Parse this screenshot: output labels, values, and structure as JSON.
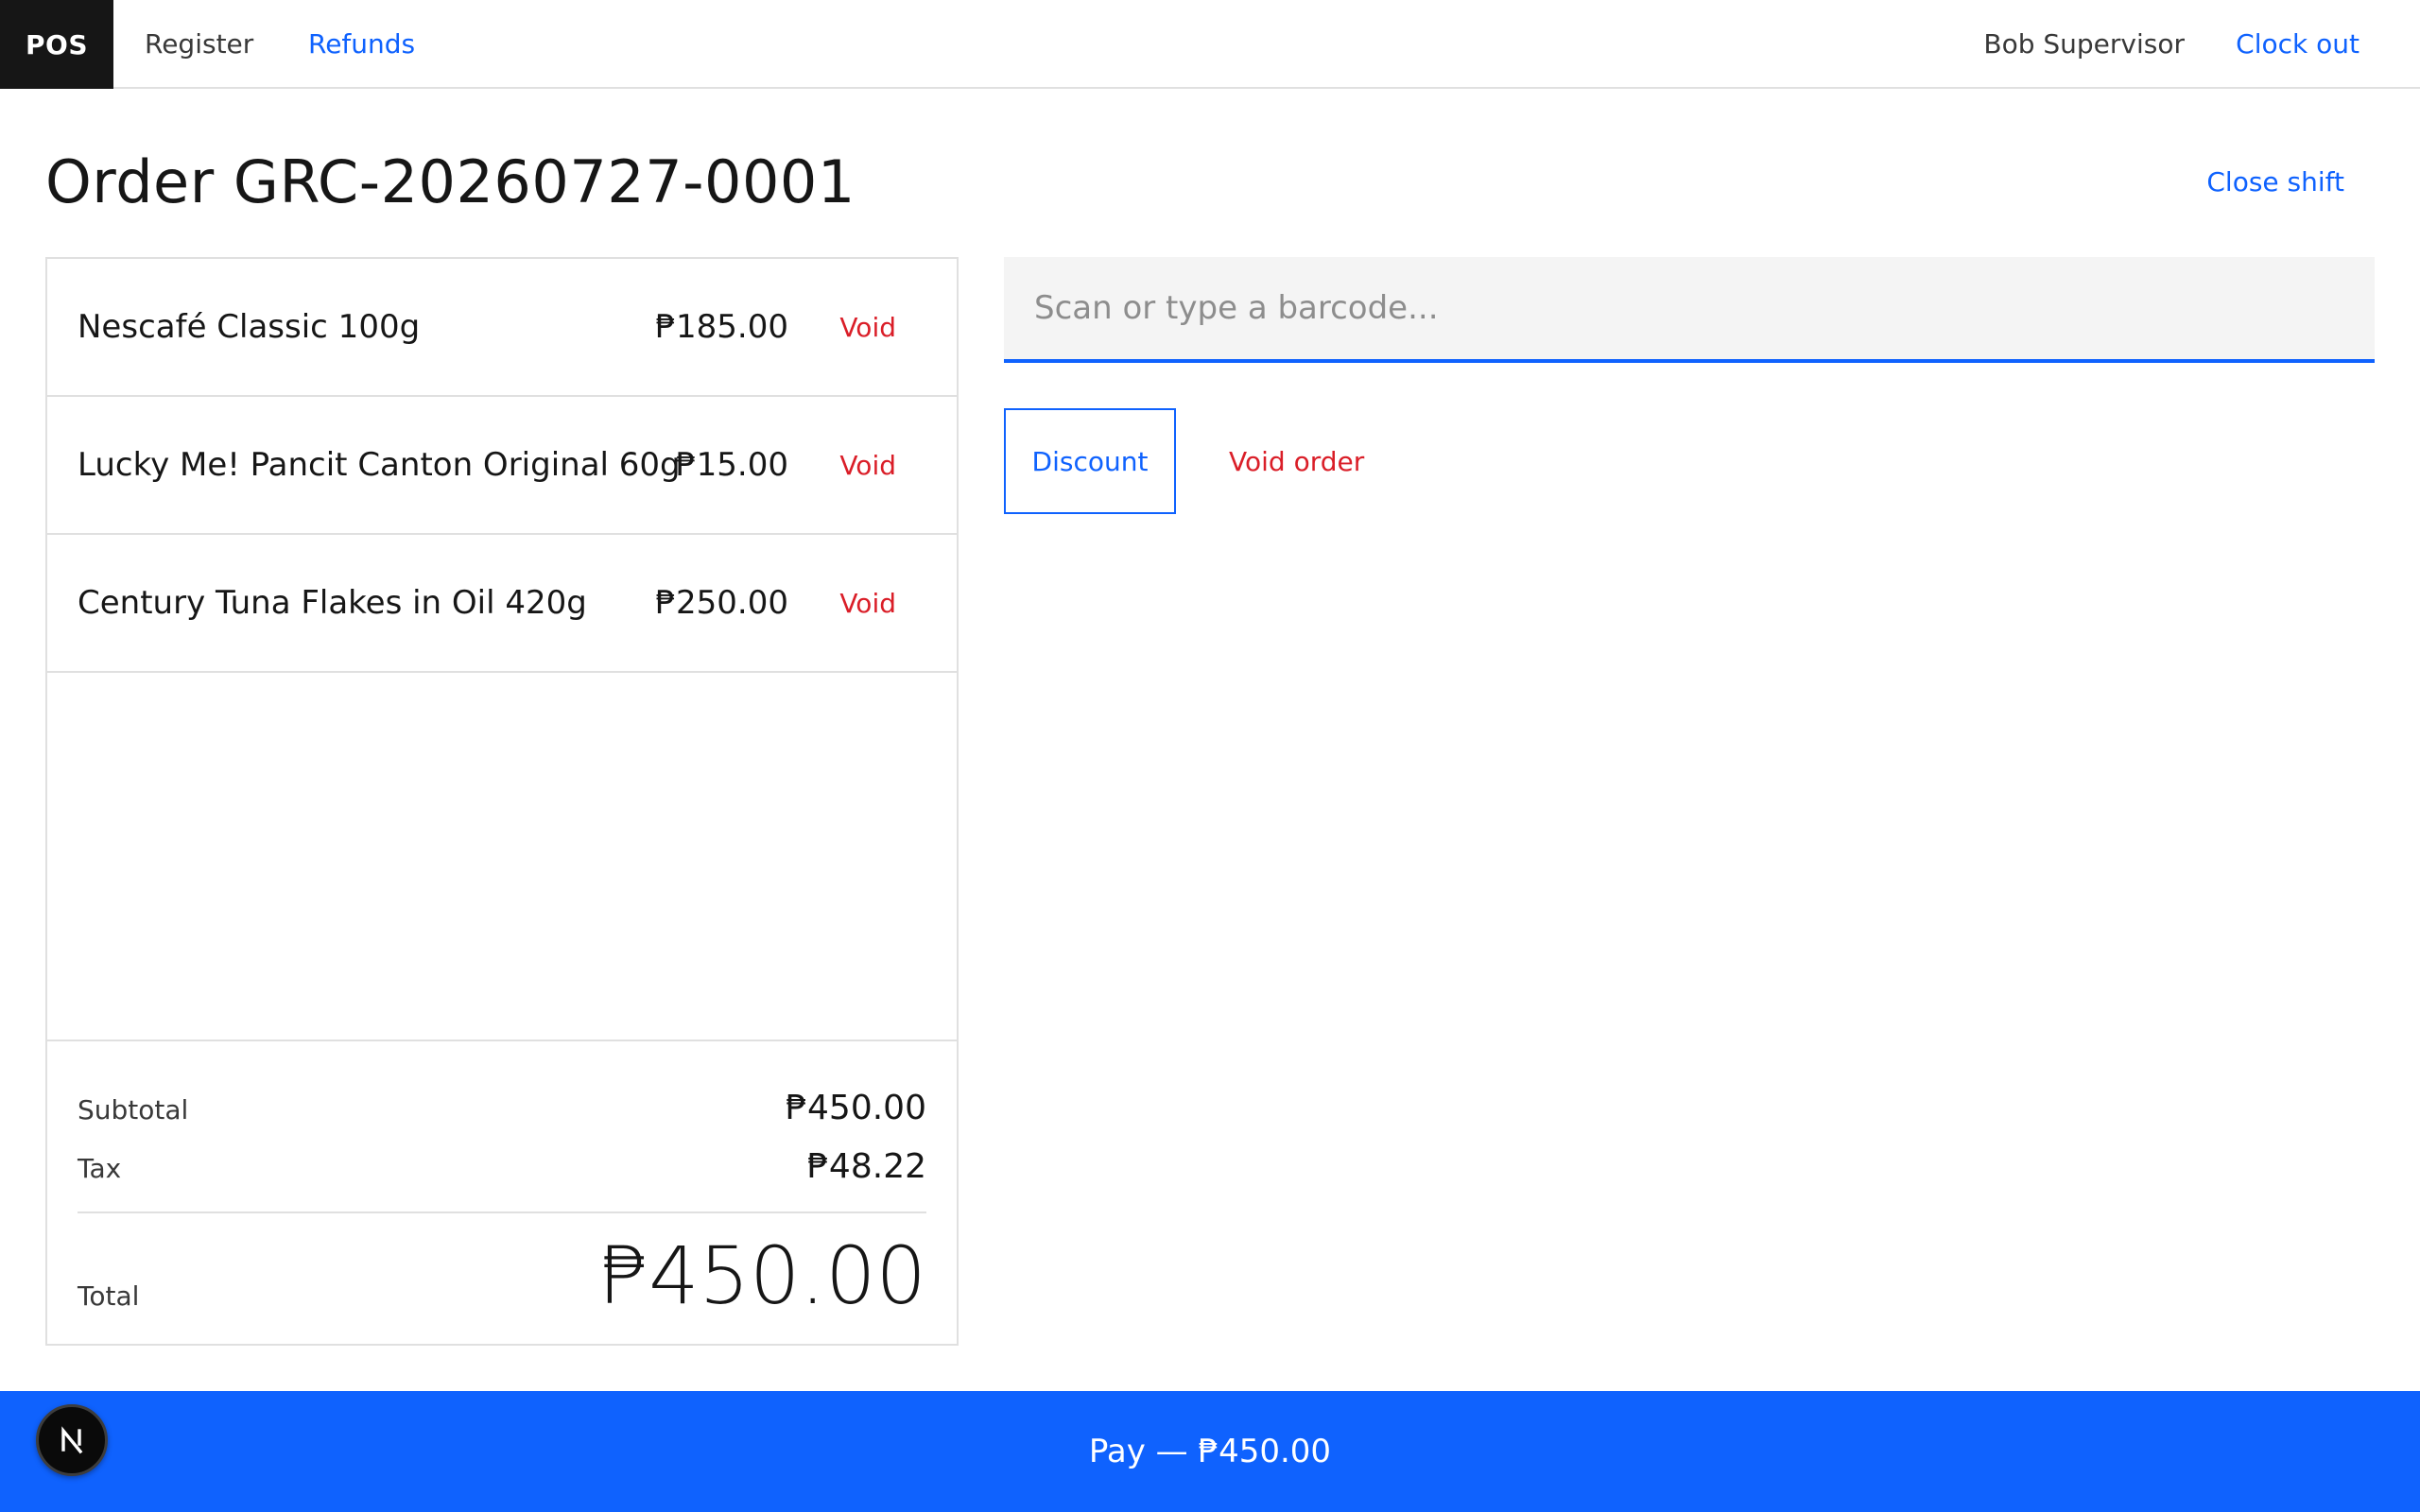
{
  "header": {
    "brand": "POS",
    "nav": [
      {
        "label": "Register"
      },
      {
        "label": "Refunds"
      }
    ],
    "user_name": "Bob Supervisor",
    "clock_out_label": "Clock out"
  },
  "page": {
    "title": "Order GRC-20260727-0001",
    "close_shift_label": "Close shift"
  },
  "order": {
    "items": [
      {
        "name": "Nescafé Classic 100g",
        "price": "₱185.00",
        "void_label": "Void"
      },
      {
        "name": "Lucky Me! Pancit Canton Original 60g",
        "price": "₱15.00",
        "void_label": "Void"
      },
      {
        "name": "Century Tuna Flakes in Oil 420g",
        "price": "₱250.00",
        "void_label": "Void"
      }
    ],
    "subtotal_label": "Subtotal",
    "subtotal_value": "₱450.00",
    "tax_label": "Tax",
    "tax_value": "₱48.22",
    "total_label": "Total",
    "total_value": "₱450.00"
  },
  "actions": {
    "barcode_placeholder": "Scan or type a barcode...",
    "discount_label": "Discount",
    "void_order_label": "Void order",
    "pay_label": "Pay — ₱450.00"
  },
  "badge": {
    "icon": "nextjs-logo-icon"
  },
  "colors": {
    "accent": "#0f62fe",
    "danger": "#da1e28",
    "text": "#161616",
    "muted": "#393939",
    "border": "#e0e0e0",
    "field_bg": "#f4f4f4",
    "brand_bg": "#161616"
  }
}
